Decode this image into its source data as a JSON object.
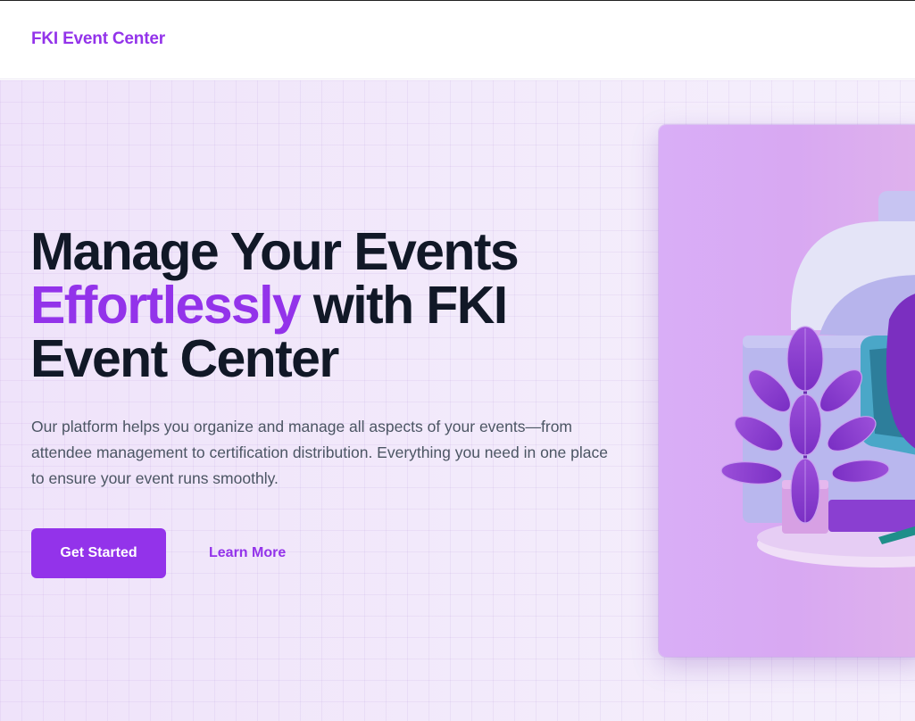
{
  "navbar": {
    "brand": "FKI Event Center"
  },
  "hero": {
    "headline_part1": "Manage Your Events",
    "headline_accent": "Effortlessly",
    "headline_part2": " with FKI Event Center",
    "description": "Our platform helps you organize and manage all aspects of your events—from attendee management to certification distribution. Everything you need in one place to ensure your event runs smoothly.",
    "primary_cta": "Get Started",
    "secondary_cta": "Learn More"
  },
  "colors": {
    "accent": "#9333ea",
    "heading": "#111827",
    "body_text": "#4b5563",
    "hero_background": "#f2e8fb"
  },
  "icons": {
    "illustration": "plant-and-workspace-illustration"
  }
}
